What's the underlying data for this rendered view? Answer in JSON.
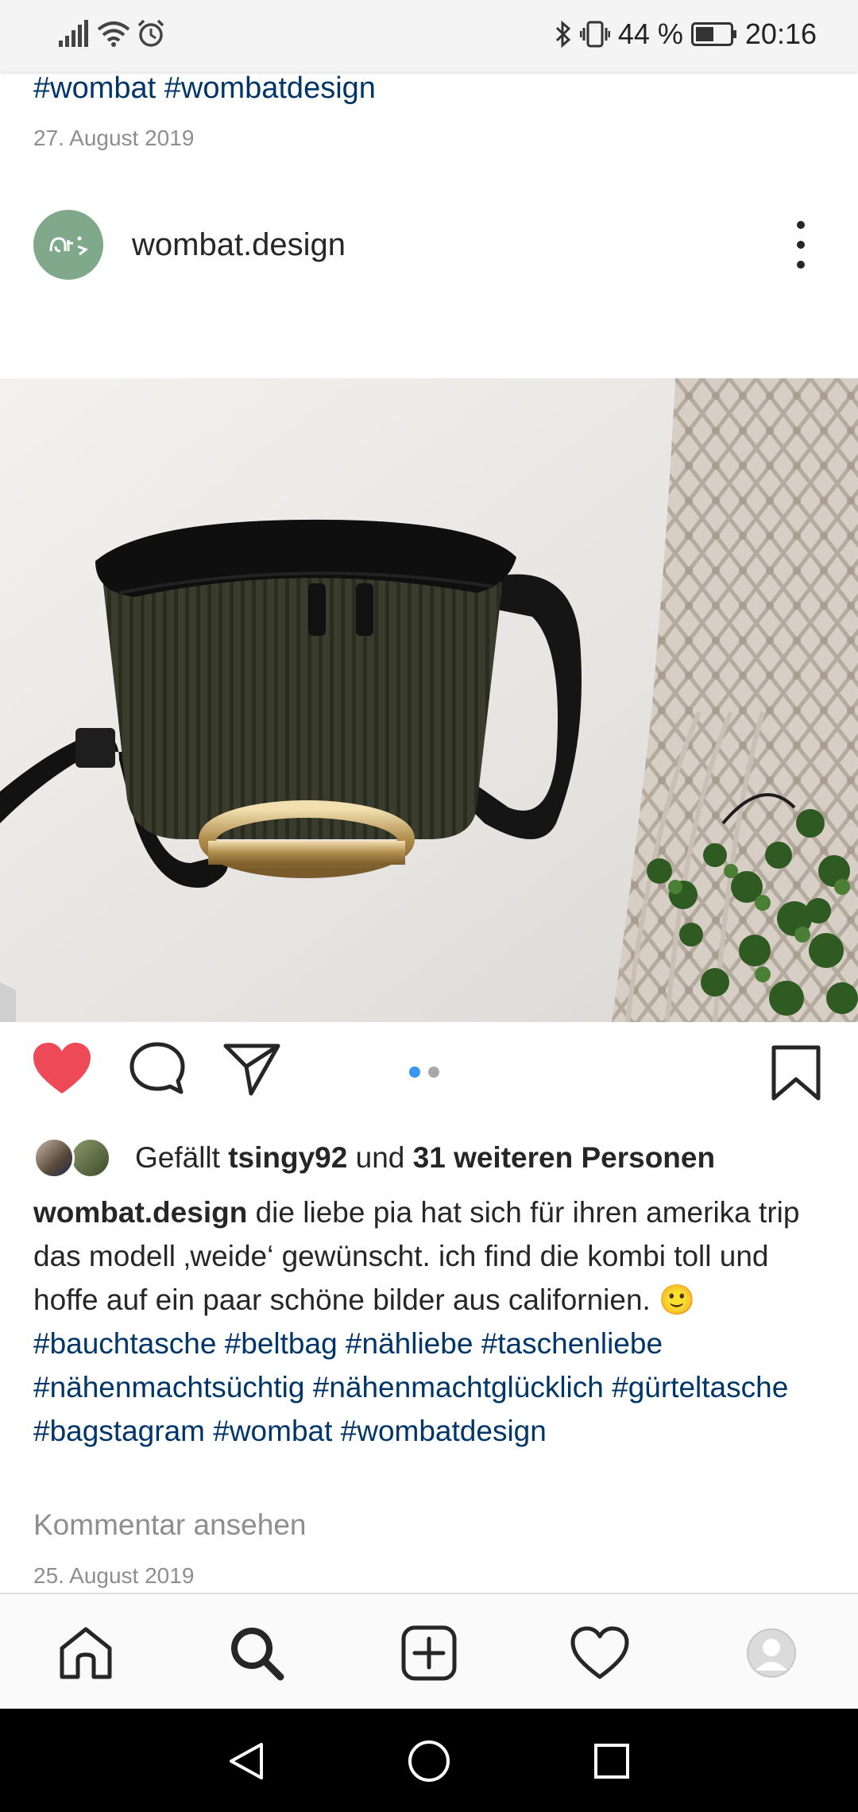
{
  "status_bar": {
    "battery": "44 %",
    "time": "20:16"
  },
  "previous_post": {
    "hashtags": "#wombat #wombatdesign",
    "date": "27. August 2019"
  },
  "post": {
    "username": "wombat.design",
    "likes": {
      "prefix": "Gefällt ",
      "first_user": "tsingy92",
      "middle": " und ",
      "others": "31 weiteren Personen"
    },
    "caption": {
      "author": "wombat.design",
      "text": " die liebe pia hat sich für ihren amerika trip das modell ‚weide‘ gewünscht. ich find die kombi toll und hoffe auf ein paar schöne bilder aus californien. 🙂  ",
      "hashtags": "#bauchtasche #beltbag #nähliebe #taschenliebe #nähenmachtsüchtig #nähenmachtglücklich #gürteltasche #bagstagram #wombat #wombatdesign"
    },
    "view_comments": "Kommentar ansehen",
    "date": "25. August 2019",
    "carousel": {
      "total": 2,
      "active": 1
    },
    "liked": true
  },
  "icons": {
    "like": "heart-filled-icon",
    "comment": "comment-icon",
    "share": "share-icon",
    "save": "bookmark-icon",
    "more": "more-vertical-icon"
  },
  "colors": {
    "like_red": "#ed4956",
    "hashtag_blue": "#003569",
    "carousel_active": "#3897f0",
    "muted": "#8e8e8e",
    "avatar_green": "#7fa98a"
  },
  "bottom_nav": [
    "home",
    "search",
    "new-post",
    "activity",
    "profile"
  ]
}
